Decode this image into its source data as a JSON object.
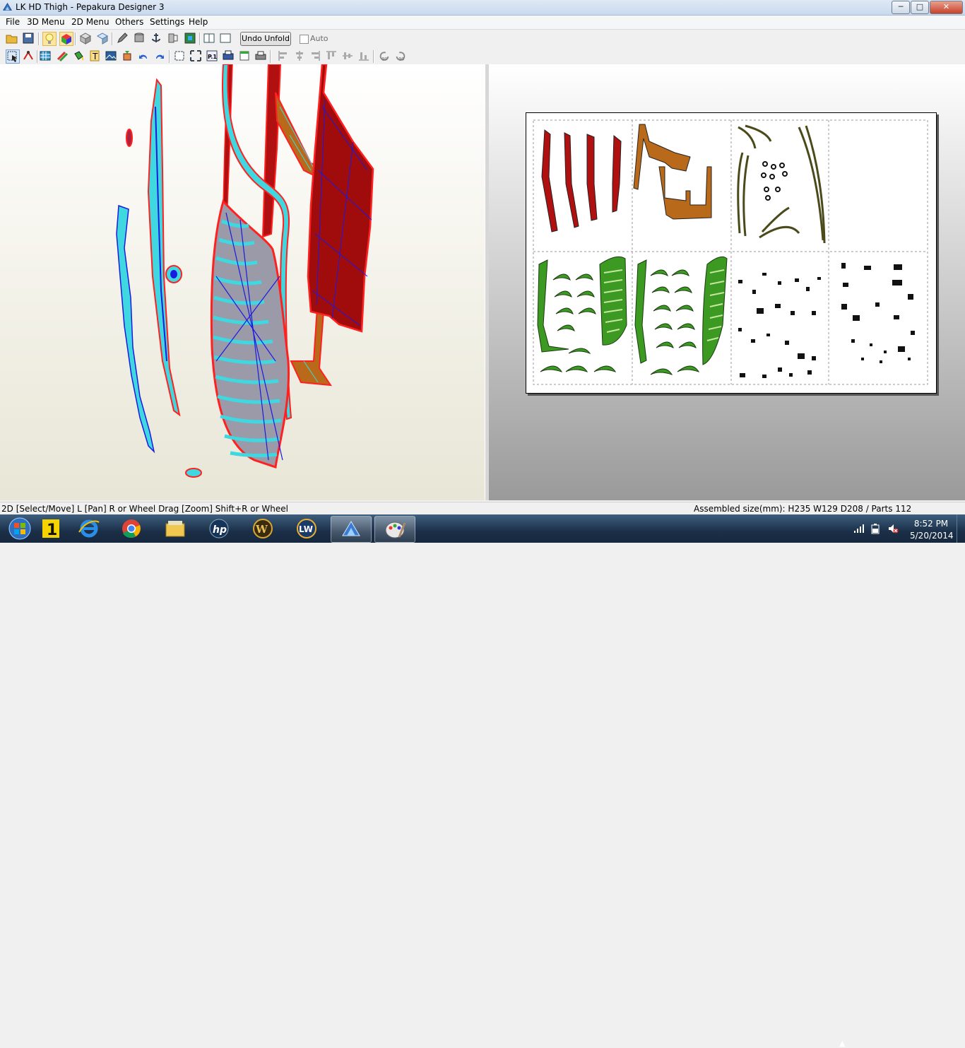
{
  "window": {
    "title": "LK HD Thigh - Pepakura Designer 3",
    "controls": {
      "minimize": "─",
      "maximize": "□",
      "close": "✕"
    }
  },
  "menu": [
    "File",
    "3D Menu",
    "2D Menu",
    "Others",
    "Settings",
    "Help"
  ],
  "toolbar1": {
    "undo_unfold_label": "Undo Unfold",
    "auto_label": "Auto",
    "auto_checked": false
  },
  "toolbar2": {
    "page_label": "P.1",
    "rotate_left_label": "90",
    "rotate_right_label": "90"
  },
  "status": {
    "left": "2D [Select/Move] L [Pan] R or Wheel Drag [Zoom] Shift+R or Wheel",
    "right": "Assembled size(mm): H235 W129 D208 / Parts 112"
  },
  "taskbar": {
    "apps": [
      "start-orb",
      "norton-1",
      "internet-explorer",
      "chrome",
      "file-explorer",
      "hp",
      "world-of-warcraft",
      "lightwave",
      "pepakura",
      "paint"
    ],
    "active": [
      "pepakura",
      "paint"
    ],
    "clock_time": "8:52 PM",
    "clock_date": "5/20/2014"
  },
  "colors": {
    "part_red": "#b01010",
    "part_orange": "#b86a1a",
    "part_green": "#3c9a22",
    "edge_cyan": "#3fd8e0",
    "edge_blue": "#1a1ae0",
    "outline_red": "#ff1a1a"
  }
}
